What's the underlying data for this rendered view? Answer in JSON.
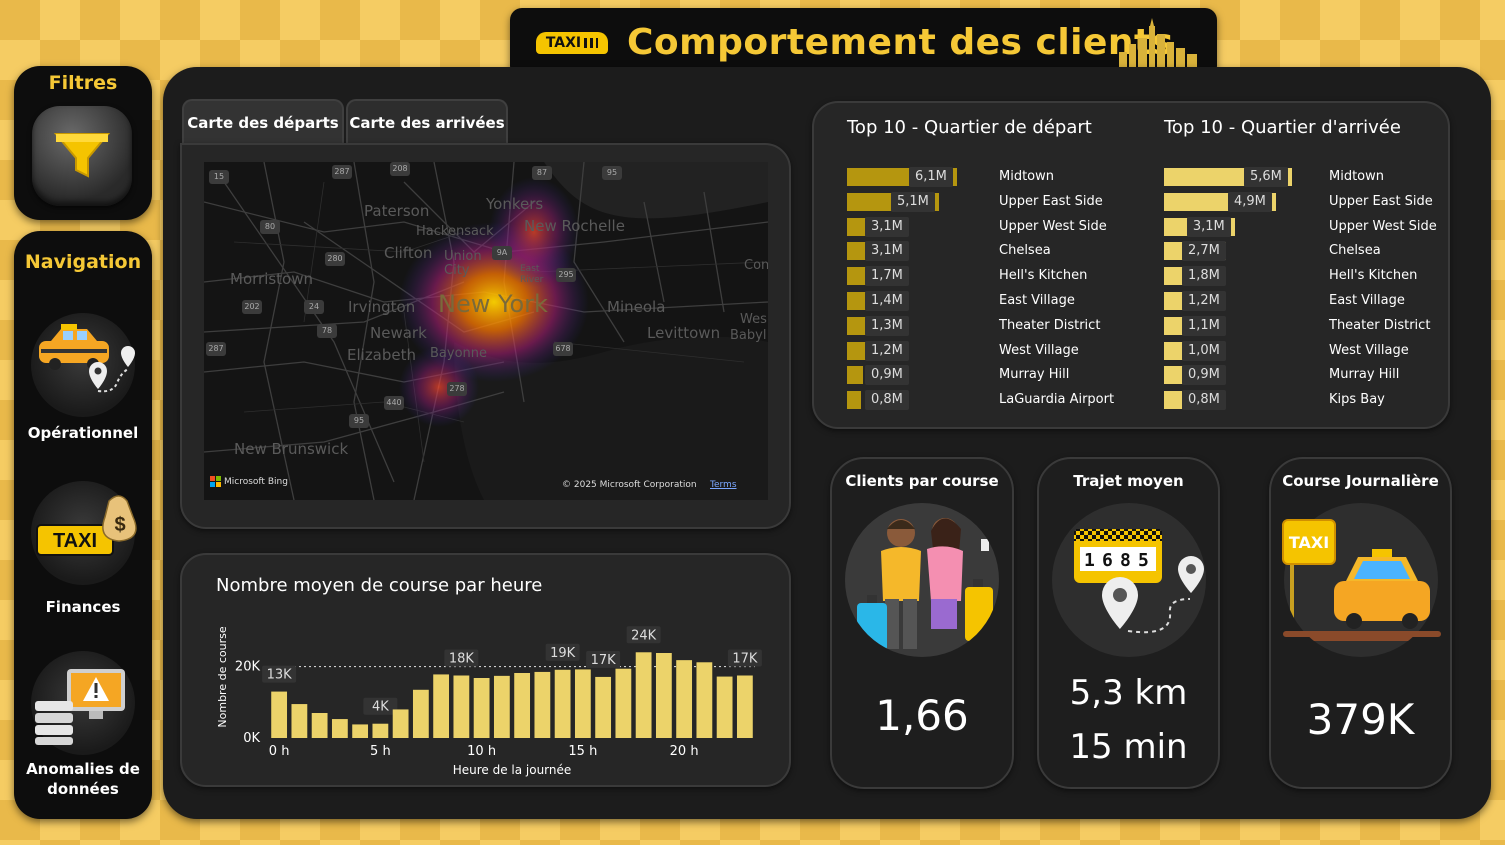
{
  "header": {
    "title": "Comportement des clients",
    "taxi_sign": "TAXI"
  },
  "filters": {
    "label": "Filtres"
  },
  "navigation": {
    "label": "Navigation",
    "items": [
      {
        "label": "Opérationnel"
      },
      {
        "label": "Finances"
      },
      {
        "label": "Anomalies de données"
      }
    ]
  },
  "map": {
    "tabs": [
      {
        "label": "Carte des départs"
      },
      {
        "label": "Carte des arrivées"
      }
    ],
    "attribution": "Microsoft Bing",
    "copyright": "© 2025 Microsoft Corporation",
    "terms": "Terms",
    "place_labels": [
      "Paterson",
      "Yonkers",
      "Hackensack",
      "New Rochelle",
      "Clifton",
      "Union City",
      "Morristown",
      "East River",
      "Irvington",
      "New York",
      "Mineola",
      "Newark",
      "Levittown",
      "Elizabeth",
      "Bayonne",
      "New Brunswick",
      "Wes",
      "Babyl",
      "Con"
    ]
  },
  "top10": {
    "departure": {
      "title": "Top 10 - Quartier de départ",
      "color": "#b5960f",
      "rows": [
        {
          "name": "Midtown",
          "label": "6,1M",
          "value": 6.1
        },
        {
          "name": "Upper East Side",
          "label": "5,1M",
          "value": 5.1
        },
        {
          "name": "Upper West Side",
          "label": "3,1M",
          "value": 3.1
        },
        {
          "name": "Chelsea",
          "label": "3,1M",
          "value": 3.1
        },
        {
          "name": "Hell's Kitchen",
          "label": "1,7M",
          "value": 1.7
        },
        {
          "name": "East Village",
          "label": "1,4M",
          "value": 1.4
        },
        {
          "name": "Theater District",
          "label": "1,3M",
          "value": 1.3
        },
        {
          "name": "West Village",
          "label": "1,2M",
          "value": 1.2
        },
        {
          "name": "Murray Hill",
          "label": "0,9M",
          "value": 0.9
        },
        {
          "name": "LaGuardia Airport",
          "label": "0,8M",
          "value": 0.8
        }
      ]
    },
    "arrival": {
      "title": "Top 10 - Quartier d'arrivée",
      "color": "#ecd36a",
      "rows": [
        {
          "name": "Midtown",
          "label": "5,6M",
          "value": 5.6
        },
        {
          "name": "Upper East Side",
          "label": "4,9M",
          "value": 4.9
        },
        {
          "name": "Upper West Side",
          "label": "3,1M",
          "value": 3.1
        },
        {
          "name": "Chelsea",
          "label": "2,7M",
          "value": 2.7
        },
        {
          "name": "Hell's Kitchen",
          "label": "1,8M",
          "value": 1.8
        },
        {
          "name": "East Village",
          "label": "1,2M",
          "value": 1.2
        },
        {
          "name": "Theater District",
          "label": "1,1M",
          "value": 1.1
        },
        {
          "name": "West Village",
          "label": "1,0M",
          "value": 1.0
        },
        {
          "name": "Murray Hill",
          "label": "0,9M",
          "value": 0.9
        },
        {
          "name": "Kips Bay",
          "label": "0,8M",
          "value": 0.8
        }
      ]
    }
  },
  "kpis": {
    "clients": {
      "title": "Clients par course",
      "value": "1,66"
    },
    "trip": {
      "title": "Trajet moyen",
      "distance": "5,3 km",
      "duration": "15 min"
    },
    "daily": {
      "title": "Course Journalière",
      "value": "379K"
    }
  },
  "chart_data": {
    "type": "bar",
    "title": "Nombre moyen de course par heure",
    "xlabel": "Heure de la journée",
    "ylabel": "Nombre de course",
    "bar_color": "#ecd36a",
    "categories": [
      0,
      1,
      2,
      3,
      4,
      5,
      6,
      7,
      8,
      9,
      10,
      11,
      12,
      13,
      14,
      15,
      16,
      17,
      18,
      19,
      20,
      21,
      22,
      23
    ],
    "values": [
      13000,
      9500,
      7000,
      5300,
      3800,
      4000,
      8000,
      13500,
      17800,
      17500,
      16800,
      17400,
      18200,
      18500,
      19100,
      19200,
      17100,
      19400,
      24000,
      23800,
      21800,
      21200,
      17200,
      17500
    ],
    "data_labels": {
      "0": "13K",
      "5": "4K",
      "9": "18K",
      "14": "19K",
      "16": "17K",
      "18": "24K",
      "23": "17K"
    },
    "x_tick_labels": [
      {
        "at": 0,
        "label": "0 h"
      },
      {
        "at": 5,
        "label": "5 h"
      },
      {
        "at": 10,
        "label": "10 h"
      },
      {
        "at": 15,
        "label": "15 h"
      },
      {
        "at": 20,
        "label": "20 h"
      }
    ],
    "y_tick_labels": [
      {
        "at": 0,
        "label": "0K"
      },
      {
        "at": 20000,
        "label": "20K"
      }
    ],
    "ylim": [
      0,
      28000
    ],
    "reference_line": 20000
  }
}
